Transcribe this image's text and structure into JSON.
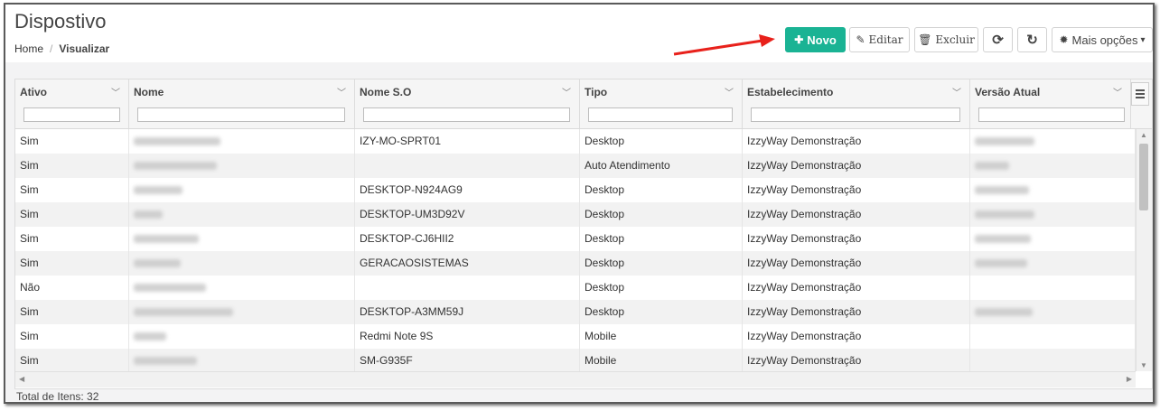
{
  "page": {
    "title": "Dispostivo",
    "breadcrumb": {
      "home": "Home",
      "separator": "/",
      "current": "Visualizar"
    }
  },
  "toolbar": {
    "novo_icon": "plus-icon",
    "novo_label": "Novo",
    "editar_icon": "pencil-icon",
    "editar_label": "Editar",
    "excluir_icon": "trash-icon",
    "excluir_label": "Excluir",
    "sync_icon": "sync-icon",
    "refresh_icon": "refresh-icon",
    "mais_icon": "gear-icon",
    "mais_label": "Mais opções",
    "mais_caret": "▾"
  },
  "annotation": {
    "arrow_color": "#e8211b",
    "arrow_icon": "red-arrow-icon"
  },
  "colors": {
    "primary": "#1ab394",
    "row_alt": "#f2f2f2"
  },
  "grid": {
    "columns": [
      {
        "label": "Ativo"
      },
      {
        "label": "Nome"
      },
      {
        "label": "Nome S.O"
      },
      {
        "label": "Tipo"
      },
      {
        "label": "Estabelecimento"
      },
      {
        "label": "Versão Atual"
      }
    ],
    "rows": [
      {
        "ativo": "Sim",
        "nome_redacted": true,
        "so": "IZY-MO-SPRT01",
        "tipo": "Desktop",
        "estab": "IzzyWay Demonstração",
        "versao_redacted": true
      },
      {
        "ativo": "Sim",
        "nome_redacted": true,
        "so": "",
        "tipo": "Auto Atendimento",
        "estab": "IzzyWay Demonstração",
        "versao_redacted": true
      },
      {
        "ativo": "Sim",
        "nome_redacted": true,
        "so": "DESKTOP-N924AG9",
        "tipo": "Desktop",
        "estab": "IzzyWay Demonstração",
        "versao_redacted": true
      },
      {
        "ativo": "Sim",
        "nome_redacted": true,
        "so": "DESKTOP-UM3D92V",
        "tipo": "Desktop",
        "estab": "IzzyWay Demonstração",
        "versao_redacted": true
      },
      {
        "ativo": "Sim",
        "nome_redacted": true,
        "so": "DESKTOP-CJ6HII2",
        "tipo": "Desktop",
        "estab": "IzzyWay Demonstração",
        "versao_redacted": true
      },
      {
        "ativo": "Sim",
        "nome_redacted": true,
        "so": "GERACAOSISTEMAS",
        "tipo": "Desktop",
        "estab": "IzzyWay Demonstração",
        "versao_redacted": true
      },
      {
        "ativo": "Não",
        "nome_redacted": true,
        "so": "",
        "tipo": "Desktop",
        "estab": "IzzyWay Demonstração",
        "versao_redacted": false
      },
      {
        "ativo": "Sim",
        "nome_redacted": true,
        "so": "DESKTOP-A3MM59J",
        "tipo": "Desktop",
        "estab": "IzzyWay Demonstração",
        "versao_redacted": true
      },
      {
        "ativo": "Sim",
        "nome_redacted": true,
        "so": "Redmi Note 9S",
        "tipo": "Mobile",
        "estab": "IzzyWay Demonstração",
        "versao_redacted": false
      },
      {
        "ativo": "Sim",
        "nome_redacted": true,
        "so": "SM-G935F",
        "tipo": "Mobile",
        "estab": "IzzyWay Demonstração",
        "versao_redacted": false
      }
    ],
    "menu_icon": "column-menu-icon"
  },
  "footer": {
    "total_label": "Total de Itens: 32"
  }
}
